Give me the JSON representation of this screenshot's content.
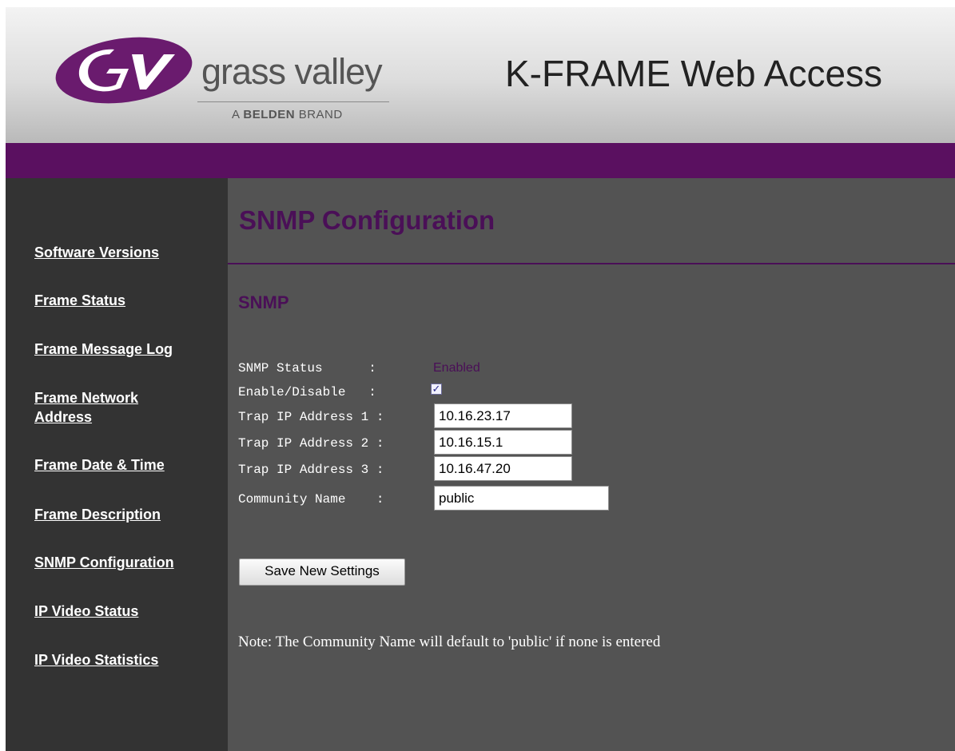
{
  "header": {
    "logo_word": "grass valley",
    "logo_sub_prefix": "A ",
    "logo_sub_brand": "BELDEN",
    "logo_sub_suffix": " BRAND",
    "app_title": "K-FRAME Web Access"
  },
  "colors": {
    "brand_purple": "#5a1060",
    "sidebar_bg": "#333333",
    "main_bg": "#535353"
  },
  "sidebar": {
    "items": [
      {
        "label": "Software Versions"
      },
      {
        "label": "Frame Status"
      },
      {
        "label": "Frame Message Log"
      },
      {
        "label": "Frame Network Address"
      },
      {
        "label": "Frame Date & Time"
      },
      {
        "label": "Frame Description"
      },
      {
        "label": "SNMP Configuration"
      },
      {
        "label": "IP Video Status"
      },
      {
        "label": "IP Video Statistics"
      }
    ]
  },
  "main": {
    "page_title": "SNMP Configuration",
    "section_title": "SNMP",
    "snmp_status_label": "SNMP Status      : ",
    "snmp_status_value": "Enabled",
    "enable_label": "Enable/Disable   : ",
    "enable_checked": true,
    "trap1_label": "Trap IP Address 1 : ",
    "trap1_value": "10.16.23.17",
    "trap2_label": "Trap IP Address 2 : ",
    "trap2_value": "10.16.15.1",
    "trap3_label": "Trap IP Address 3 : ",
    "trap3_value": "10.16.47.20",
    "community_label": "Community Name    : ",
    "community_value": "public",
    "save_button": "Save New Settings",
    "note": "Note: The Community Name will default to 'public' if none is entered"
  }
}
